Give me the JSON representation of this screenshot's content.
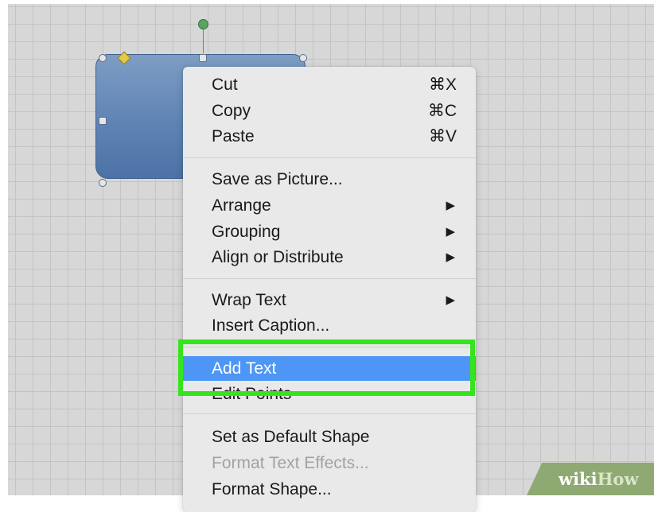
{
  "menu": {
    "items": [
      {
        "label": "Cut",
        "shortcut": "⌘X"
      },
      {
        "label": "Copy",
        "shortcut": "⌘C"
      },
      {
        "label": "Paste",
        "shortcut": "⌘V"
      },
      {
        "label": "Save as Picture..."
      },
      {
        "label": "Arrange",
        "submenu": true
      },
      {
        "label": "Grouping",
        "submenu": true
      },
      {
        "label": "Align or Distribute",
        "submenu": true
      },
      {
        "label": "Wrap Text",
        "submenu": true
      },
      {
        "label": "Insert Caption..."
      },
      {
        "label": "Add Text",
        "highlighted": true
      },
      {
        "label": "Edit Points"
      },
      {
        "label": "Set as Default Shape"
      },
      {
        "label": "Format Text Effects...",
        "disabled": true
      },
      {
        "label": "Format Shape..."
      }
    ],
    "submenu_arrow": "▶"
  },
  "watermark": {
    "wiki": "wiki",
    "how": "How"
  },
  "colors": {
    "highlight": "#4d96f6",
    "annotation_box": "#35e41e",
    "shape_fill": "#5f84b4",
    "canvas": "#d7d7d7"
  }
}
